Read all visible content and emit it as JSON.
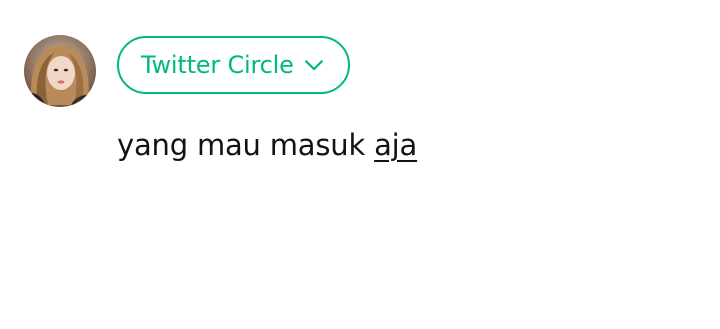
{
  "composer": {
    "avatar_icon": "user-avatar",
    "audience": {
      "label": "Twitter Circle",
      "icon": "chevron-down-icon",
      "color": "#00ba7c"
    },
    "text": {
      "plain": "yang mau masuk ",
      "underlined": "aja",
      "color": "#0f1419"
    }
  }
}
